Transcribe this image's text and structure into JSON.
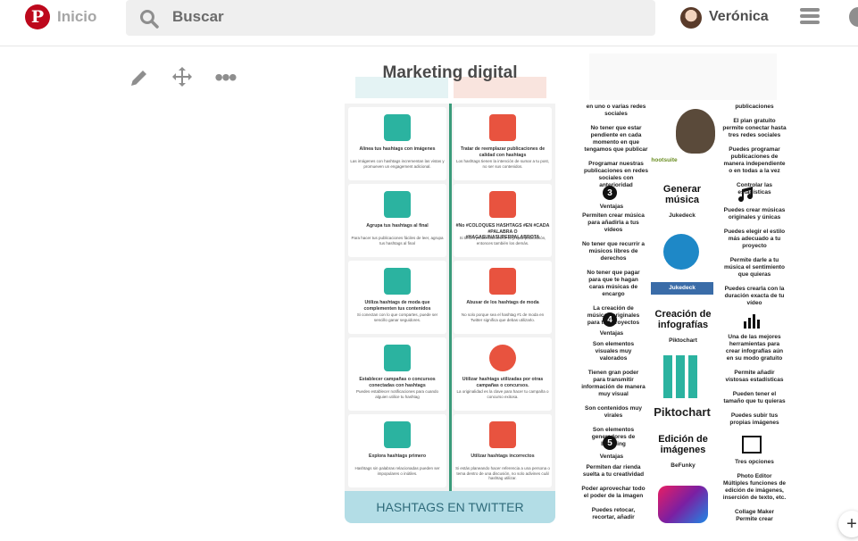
{
  "header": {
    "logo_letter": "P",
    "home_label": "Inicio",
    "search_placeholder": "Buscar",
    "user_name": "Verónica"
  },
  "board": {
    "title": "Marketing digital"
  },
  "pin_hashtags": {
    "left": [
      {
        "title": "Alinea tus hashtags con imágenes",
        "text": "Las imágenes con hashtags incrementan las vistas y promueven un engagement adicional."
      },
      {
        "title": "Agrupa tus hashtags al final",
        "text": "Para hacer tus publicaciones fáciles de leer, agrupa tus hashtags al final"
      },
      {
        "title": "Utiliza hashtags de moda que complementen tus contenidos",
        "text": "Si conectan con lo que compartes, puede ser sencillo ganar seguidores."
      },
      {
        "title": "Establecer campañas o concursos conectadas con hashtags",
        "text": "Puedes establecer notificaciones para cuando alguien utilice tu hashtag"
      },
      {
        "title": "Explora hashtags primero",
        "text": "Hashtags sin palabras relacionadas pueden ser impopulares o inútiles."
      }
    ],
    "right": [
      {
        "title": "Tratar de reemplazar publicaciones de calidad con hashtags",
        "text": "Los hashtags tienen la intención de sumar a tu post, no ser sus contenidos."
      },
      {
        "title": "#No #COLOQUES HASHTAGS #EN #CADA #PALABRA O #HAGASUNASUPERPALABROTA",
        "text": "Si tienes problemas al leer tu propia publicación, entonces también los demás."
      },
      {
        "title": "Abusar de los hashtags de moda",
        "text": "No solo porque sea el hashtag #1 de moda en Twitter significa que debas utilizarlo."
      },
      {
        "title": "Utilizar hashtags utilizadas por otras campañas o concursos.",
        "text": "La originalidad es la clave para hacer tu campaña o concurso exitosa."
      },
      {
        "title": "Utilizar hashtags incorrectos",
        "text": "Si estás planeando hacer referencia a una persona o tema dentro de una discusión, no solo adivines cuál hashtag utilizar."
      }
    ],
    "footer": "HASHTAGS EN TWITTER",
    "icon_colors": [
      "#2bb3a0",
      "#e8533f"
    ]
  },
  "pin_tools": {
    "col_left_1": "en uno o varias redes sociales\n\nNo tener que estar pendiente en cada momento en que tengamos que publicar\n\nProgramar nuestras publicaciones en redes sociales con anterioridad",
    "col_right_1": "publicaciones\n\nEl plan gratuito permite conectar hasta tres redes sociales\n\nPuedes programar publicaciones de manera independiente o en todas a la vez\n\nControlar las estadísticas",
    "hootsuite": "hootsuite",
    "n3": "3",
    "ventajas3": "Ventajas",
    "gen_music": "Generar música",
    "jukedeck": "Jukedeck",
    "jukedeck_logo": "Jukedeck",
    "music_left": "Permiten crear música para añadirla a tus vídeos\n\nNo tener que recurrir a músicos libres de derechos\n\nNo tener que pagar para que te hagan caras músicas de encargo\n\nLa creación de músicas originales para tus proyectos",
    "music_right": "Puedes crear músicas originales y únicas\n\nPuedes elegir el estilo más adecuado a tu proyecto\n\nPermite darle a tu música el sentimiento que quieras\n\nPuedes crearla con la duración exacta de tu vídeo",
    "n4": "4",
    "ventajas4": "Ventajas",
    "infog": "Creación de infografías",
    "piktochart": "Piktochart",
    "piktochart_logo": "Piktochart",
    "info_left": "Son elementos visuales muy valorados\n\nTienen gran poder para transmitir información de manera muy visual\n\nSon contenidos muy virales\n\nSon elementos generadores de branding",
    "info_right": "Una de las mejores herramientas para crear infografías aún en su modo gratuito\n\nPermite añadir vistosas estadísticas\n\nPueden tener el tamaño que tu quieras\n\nPuedes subir tus propias imágenes",
    "n5": "5",
    "ventajas5": "Ventajas",
    "edicion": "Edición de imágenes",
    "befunky": "BeFunky",
    "img_left": "Permiten dar rienda suelta a tu creatividad\n\nPoder aprovechar todo el poder de la imagen\n\nPuedes retocar, recortar, añadir",
    "img_right": "Tres opciones\n\nPhoto Editor\nMúltiples funciones de edición de imágenes, inserción de texto, etc.\n\nCollage Maker\nPermite crear"
  }
}
